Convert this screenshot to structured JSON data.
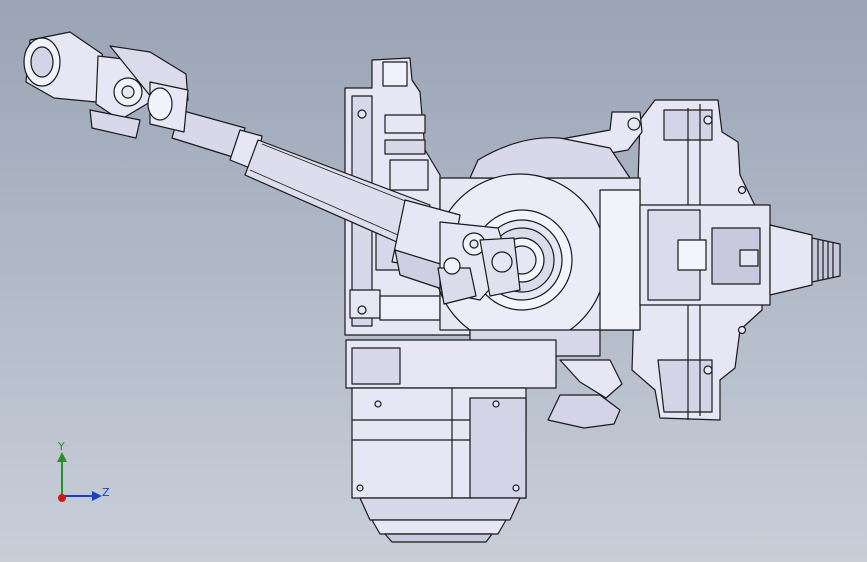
{
  "viewport": {
    "background_top": "#9aa4b5",
    "background_bottom": "#c9cfd9",
    "model": {
      "type": "electric power steering column assembly",
      "fill": "#e6e6f4",
      "shade": "#c9c8de",
      "edge": "#1a1a1a"
    },
    "triad": {
      "y_label": "Y",
      "z_label": "Z",
      "y_color": "#2e8b2e",
      "z_color": "#1d3fc2",
      "origin_color": "#d01818"
    }
  }
}
